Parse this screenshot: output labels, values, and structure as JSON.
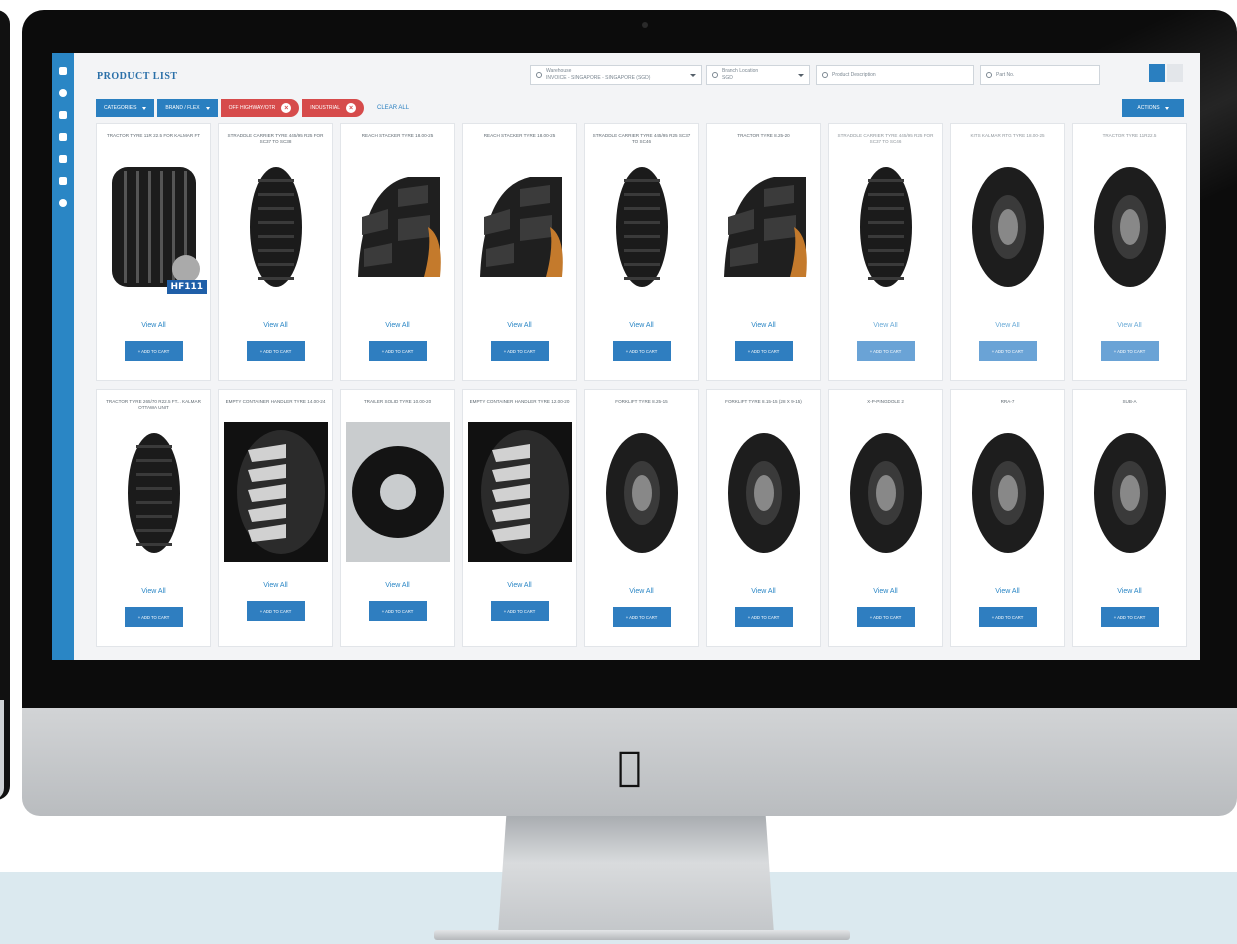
{
  "header": {
    "title": "PRODUCT LIST",
    "warehouse_label": "Warehouse",
    "warehouse_value": "INVOICE - SINGAPORE - SINGAPORE (SGD)",
    "price_label": "Branch Location",
    "price_value": "SGD",
    "search_desc_placeholder": "Product Description",
    "search_code_placeholder": "Part No."
  },
  "filters": {
    "categories": "CATEGORIES",
    "brand": "BRAND / FLEX",
    "chip1": "OFF HIGHWAY/OTR",
    "chip2": "INDUSTRIAL",
    "clear": "CLEAR ALL",
    "actions": "ACTIONS"
  },
  "products": [
    {
      "name": "TRACTOR TYRE 11R 22.5 FOR KALMAR FT",
      "view": "View All",
      "add": "+ ADD TO CART",
      "badge": "HF111"
    },
    {
      "name": "STRADDLE CARRIER TYRE 445/95 R25 FOR SC37 TO SC38",
      "view": "View All",
      "add": "+ ADD TO CART"
    },
    {
      "name": "REACH STACKER TYRE 18.00-25",
      "view": "View All",
      "add": "+ ADD TO CART"
    },
    {
      "name": "REACH STACKER TYRE 18.00-25",
      "view": "View All",
      "add": "+ ADD TO CART"
    },
    {
      "name": "STRADDLE CARRIER TYRE 445/95 R25 SC37 TO SC46",
      "view": "View All",
      "add": "+ ADD TO CART"
    },
    {
      "name": "TRACTOR TYRE 8.25-20",
      "view": "View All",
      "add": "+ ADD TO CART"
    },
    {
      "name": "STRADDLE CARRIER TYRE 445/95 R25 FOR SC37 TO SC46",
      "view": "View All",
      "add": "+ ADD TO CART"
    },
    {
      "name": "KITS KALMAR RTG TYRE 18.00-25",
      "view": "View All",
      "add": "+ ADD TO CART"
    },
    {
      "name": "TRACTOR TYRE 11R22.5",
      "view": "View All",
      "add": "+ ADD TO CART"
    },
    {
      "name": "TRACTOR TYRE 265/70 R22.5 FT... KALMAR OTTAWA UNIT",
      "view": "View All",
      "add": "+ ADD TO CART"
    },
    {
      "name": "EMPTY CONTAINER HANDLER TYRE 14.00-24",
      "view": "View All",
      "add": "+ ADD TO CART"
    },
    {
      "name": "TRAILER SOLID TYRE 10.00-20",
      "view": "View All",
      "add": "+ ADD TO CART"
    },
    {
      "name": "EMPTY CONTAINER HANDLER TYRE 12.00-20",
      "view": "View All",
      "add": "+ ADD TO CART"
    },
    {
      "name": "FORKLIFT TYRE 8.25-15",
      "view": "View All",
      "add": "+ ADD TO CART"
    },
    {
      "name": "FORKLIFT TYRE 8.15-15 (28 X 9-15)",
      "view": "View All",
      "add": "+ ADD TO CART"
    },
    {
      "name": "X-P-PINGDOLE 2",
      "view": "View All",
      "add": "+ ADD TO CART"
    },
    {
      "name": "RRA-7",
      "view": "View All",
      "add": "+ ADD TO CART"
    },
    {
      "name": "SUB-A",
      "view": "View All",
      "add": "+ ADD TO CART"
    }
  ],
  "colors": {
    "primary": "#2a7fc0",
    "danger": "#d64b4b",
    "title": "#2a6fa8"
  }
}
